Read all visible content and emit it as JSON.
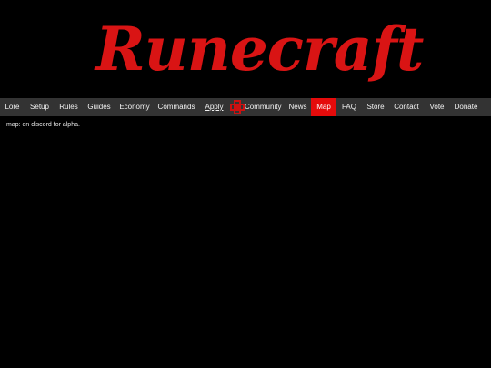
{
  "site": {
    "logo_text": "Runecraft"
  },
  "nav": {
    "items": [
      {
        "label": "Lore"
      },
      {
        "label": "Setup"
      },
      {
        "label": "Rules"
      },
      {
        "label": "Guides"
      },
      {
        "label": "Economy"
      },
      {
        "label": "Commands"
      },
      {
        "label": "Apply"
      },
      {
        "label": "Community",
        "icon": "community-knot-icon"
      },
      {
        "label": "News"
      },
      {
        "label": "Map",
        "active": true
      },
      {
        "label": "FAQ"
      },
      {
        "label": "Store"
      },
      {
        "label": "Contact"
      },
      {
        "label": "Vote"
      },
      {
        "label": "Donate"
      }
    ]
  },
  "main": {
    "text": "map: on discord for alpha."
  },
  "colors": {
    "background": "#000000",
    "logo": "#d91414",
    "nav_bar": "#333333",
    "nav_active": "#e50b0b",
    "icon": "#cc1111"
  }
}
